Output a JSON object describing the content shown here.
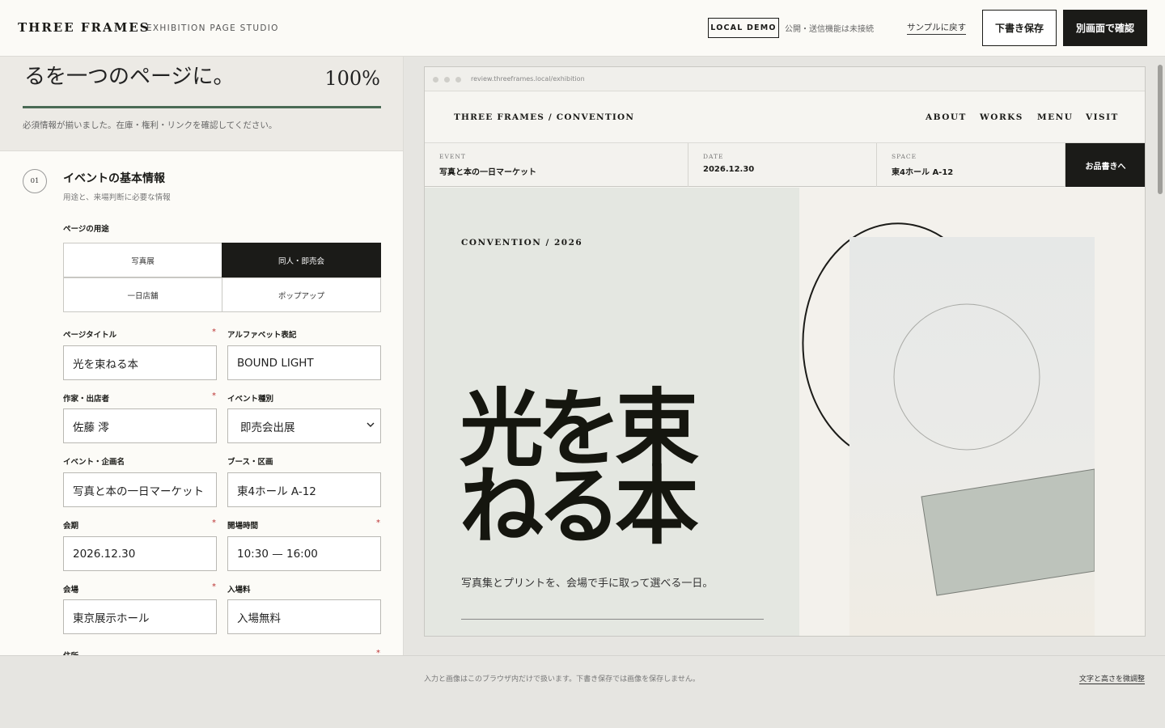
{
  "header": {
    "brand": "THREE FRAMES",
    "subtitle": "EXHIBITION PAGE STUDIO",
    "badge": "LOCAL DEMO",
    "note": "公開・送信機能は未接続",
    "back_link": "サンプルに戻す",
    "save_button": "下書き保存",
    "confirm_button": "別画面で確認"
  },
  "progress": {
    "title": "るを一つのページに。",
    "percent_label": "100%",
    "percent": 100,
    "note": "必須情報が揃いました。在庫・権利・リンクを確認してください。"
  },
  "section": {
    "number": "01",
    "title": "イベントの基本情報",
    "subtitle": "用途と、来場判断に必要な情報"
  },
  "purpose": {
    "label": "ページの用途",
    "options": [
      "写真展",
      "同人・即売会",
      "一日店舗",
      "ポップアップ"
    ],
    "selected": "同人・即売会"
  },
  "fields": {
    "page_title": {
      "label": "ページタイトル",
      "value": "光を束ねる本"
    },
    "alpha": {
      "label": "アルファベット表記",
      "value": "BOUND LIGHT"
    },
    "author": {
      "label": "作家・出店者",
      "value": "佐藤 澪"
    },
    "event_type": {
      "label": "イベント種別",
      "value": "即売会出展"
    },
    "event_name": {
      "label": "イベント・企画名",
      "value": "写真と本の一日マーケット"
    },
    "booth": {
      "label": "ブース・区画",
      "value": "東4ホール A-12"
    },
    "date": {
      "label": "会期",
      "value": "2026.12.30"
    },
    "hours": {
      "label": "開場時間",
      "value": "10:30 — 16:00"
    },
    "venue": {
      "label": "会場",
      "value": "東京展示ホール"
    },
    "fee": {
      "label": "入場料",
      "value": "入場無料"
    },
    "address": {
      "label": "住所"
    }
  },
  "required_mark": "*",
  "preview": {
    "url": "review.threeframes.local/exhibition",
    "brand": "THREE FRAMES / CONVENTION",
    "nav": [
      "ABOUT",
      "WORKS",
      "MENU",
      "VISIT"
    ],
    "info": [
      {
        "key": "EVENT",
        "value": "写真と本の一日マーケット"
      },
      {
        "key": "DATE",
        "value": "2026.12.30"
      },
      {
        "key": "SPACE",
        "value": "東4ホール A-12"
      }
    ],
    "cta": "お品書きへ",
    "kicker": "CONVENTION / 2026",
    "title_line1": "光を束",
    "title_line2": "ねる本",
    "copy": "写真集とプリントを、会場で手に取って選べる一日。"
  },
  "footer": {
    "note": "入力と画像はこのブラウザ内だけで扱います。下書き保存では画像を保存しません。",
    "link": "文字と高さを微調整"
  },
  "colors": {
    "ink": "#1b1b18",
    "accent_green": "#4a6b55",
    "required": "#b33333"
  }
}
